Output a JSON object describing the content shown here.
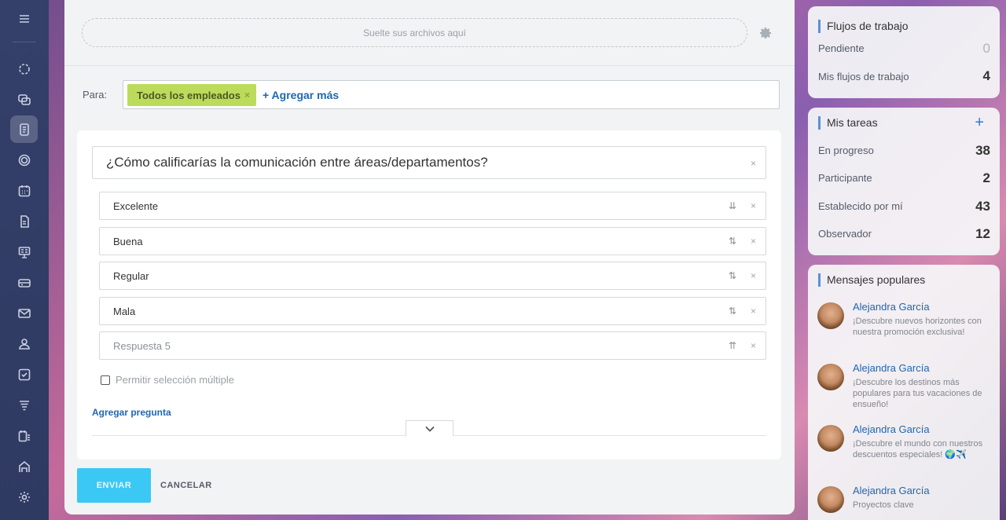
{
  "rail": {
    "items": [
      "menu",
      "activity",
      "chat",
      "feed",
      "pulse",
      "calendar",
      "docs",
      "boards",
      "storage",
      "mail",
      "contacts",
      "tasks",
      "filter",
      "planner",
      "sites",
      "settings"
    ]
  },
  "composer": {
    "drop_text": "Suelte sus archivos aquí",
    "to_label": "Para:",
    "recipient_tag": "Todos los empleados",
    "add_more": "+ Agregar más"
  },
  "poll": {
    "question": "¿Cómo calificarías la comunicación entre áreas/departamentos?",
    "answers": [
      "Excelente",
      "Buena",
      "Regular",
      "Mala"
    ],
    "answer_placeholder": "Respuesta 5",
    "multiple_label": "Permitir selección múltiple",
    "add_question": "Agregar pregunta"
  },
  "actions": {
    "send": "ENVIAR",
    "cancel": "CANCELAR"
  },
  "workflows": {
    "title": "Flujos de trabajo",
    "rows": [
      {
        "label": "Pendiente",
        "value": "0"
      },
      {
        "label": "Mis flujos de trabajo",
        "value": "4"
      }
    ]
  },
  "tasks": {
    "title": "Mis tareas",
    "add": "+",
    "rows": [
      {
        "label": "En progreso",
        "value": "38"
      },
      {
        "label": "Participante",
        "value": "2"
      },
      {
        "label": "Establecido por mí",
        "value": "43"
      },
      {
        "label": "Observador",
        "value": "12"
      }
    ]
  },
  "popular": {
    "title": "Mensajes populares",
    "messages": [
      {
        "author": "Alejandra García",
        "text": "¡Descubre nuevos horizontes con nuestra promoción exclusiva!"
      },
      {
        "author": "Alejandra García",
        "text": "¡Descubre los destinos más populares para tus vacaciones de ensueño!"
      },
      {
        "author": "Alejandra García",
        "text": "¡Descubre el mundo con nuestros descuentos especiales! 🌍✈️"
      },
      {
        "author": "Alejandra García",
        "text": "Proyectos clave"
      }
    ]
  },
  "colors": {
    "accent": "#2067b0",
    "tag": "#bcdb5b",
    "send": "#3bc8f5"
  }
}
